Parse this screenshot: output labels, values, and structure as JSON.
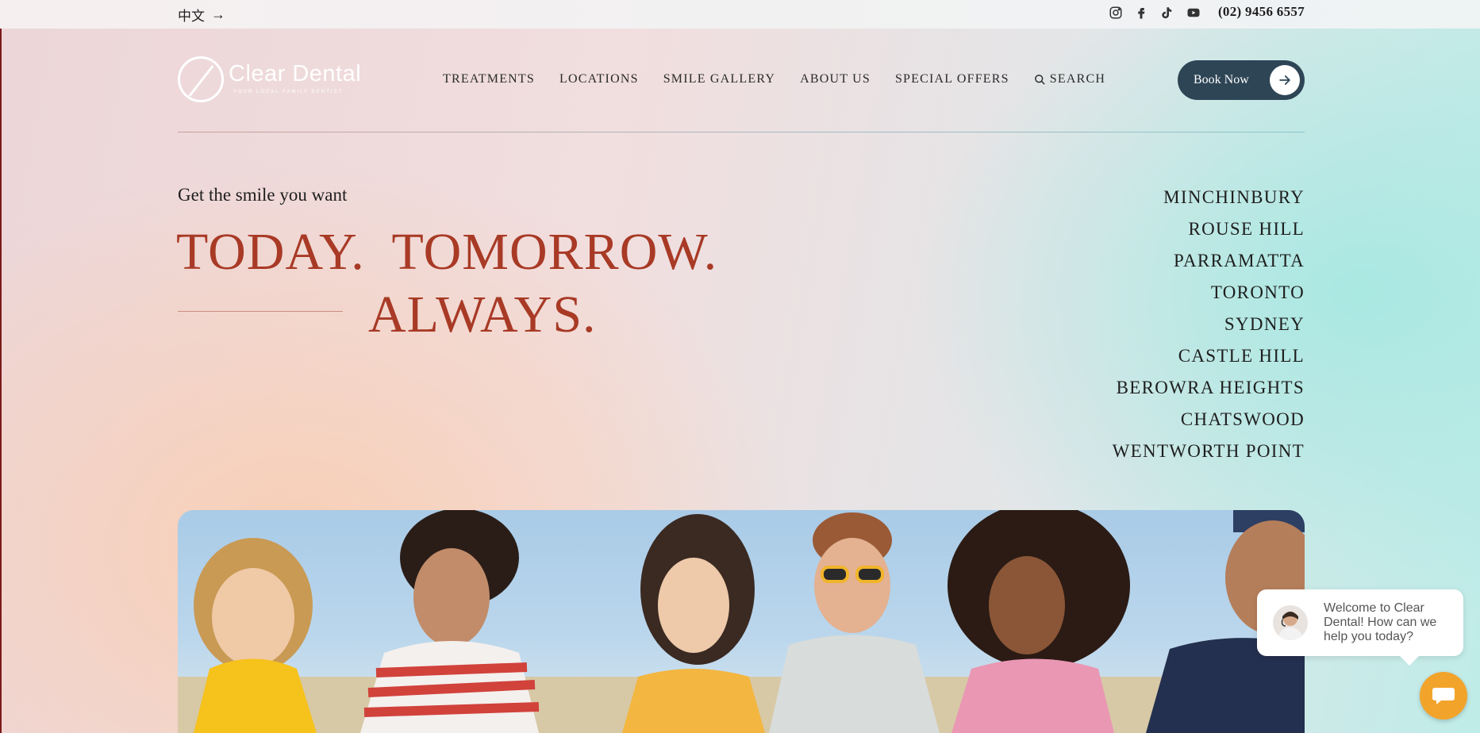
{
  "topbar": {
    "language_label": "中文",
    "phone": "(02) 9456 6557",
    "social_icons": [
      "instagram-icon",
      "facebook-icon",
      "tiktok-icon",
      "youtube-icon"
    ]
  },
  "header": {
    "logo_text": "Clear Dental",
    "logo_tagline": "YOUR LOCAL FAMILY DENTIST",
    "nav": [
      "TREATMENTS",
      "LOCATIONS",
      "SMILE GALLERY",
      "ABOUT US",
      "SPECIAL OFFERS"
    ],
    "search_label": "SEARCH",
    "book_label": "Book Now"
  },
  "hero": {
    "subtitle": "Get the smile you want",
    "headline_1": "TODAY.  TOMORROW.",
    "headline_2": "ALWAYS.",
    "locations": [
      "MINCHINBURY",
      "ROUSE HILL",
      "PARRAMATTA",
      "TORONTO",
      "SYDNEY",
      "CASTLE HILL",
      "BEROWRA HEIGHTS",
      "CHATSWOOD",
      "WENTWORTH POINT"
    ]
  },
  "chat": {
    "message": "Welcome to Clear Dental! How can we help you today?"
  },
  "colors": {
    "accent_red": "#a83a26",
    "book_button": "#2e4556",
    "chat_button": "#f2a42a"
  }
}
